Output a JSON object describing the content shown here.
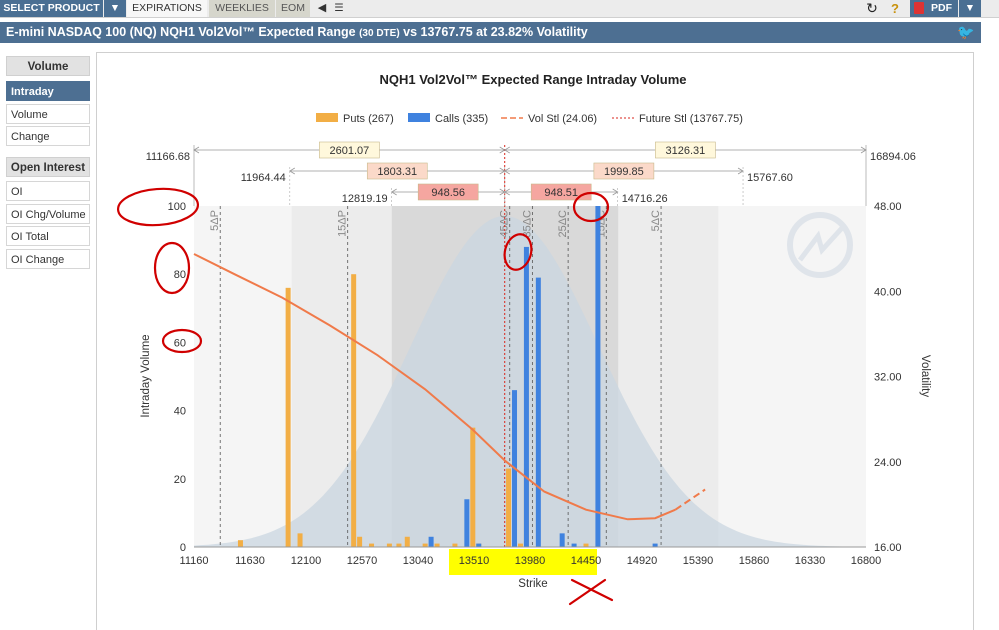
{
  "toolbar": {
    "select_product": "SELECT PRODUCT",
    "tabs": [
      "EXPIRATIONS",
      "WEEKLIES",
      "EOM"
    ],
    "pdf": "PDF"
  },
  "header": {
    "title_main": "E-mini NASDAQ 100 (NQ) NQH1 Vol2Vol™ Expected Range",
    "title_dte": "(30 DTE)",
    "title_tail": "vs 13767.75 at 23.82% Volatility"
  },
  "sidebar": {
    "volume_header": "Volume",
    "volume_items": [
      "Intraday",
      "Volume",
      "Change"
    ],
    "oi_header": "Open Interest",
    "oi_items": [
      "OI",
      "OI Chg/Volume",
      "OI Total",
      "OI Change"
    ],
    "active": "Intraday"
  },
  "colors": {
    "puts": "#f2ae45",
    "calls": "#3f82df",
    "vol_line": "#f07a4a",
    "future_line": "#d9261c",
    "bell": "#c9d5e0",
    "band_dark": "#d9d9d9",
    "band_light": "#ececec",
    "range_fill": "#f5a6a0",
    "range_fill_light": "#fbd9c9",
    "box_fill": "#fff8dc",
    "annotation": "#d00000",
    "highlight": "#ffff00"
  },
  "chart_data": {
    "type": "bar",
    "title": "NQH1 Vol2Vol™ Expected Range Intraday Volume",
    "xlabel": "Strike",
    "ylabel": "Intraday Volume",
    "y2label": "Volatility",
    "xlim": [
      11160,
      16800
    ],
    "ylim": [
      0,
      100
    ],
    "y2lim": [
      16,
      48
    ],
    "x_ticks": [
      11160,
      11630,
      12100,
      12570,
      13040,
      13510,
      13980,
      14450,
      14920,
      15390,
      15860,
      16330,
      16800
    ],
    "y_ticks": [
      0,
      20,
      40,
      60,
      80,
      100
    ],
    "y2_ticks": [
      "16.00",
      "24.00",
      "32.00",
      "40.00",
      "48.00"
    ],
    "legend": [
      {
        "name": "Puts (267)",
        "kind": "bar",
        "color": "#f2ae45"
      },
      {
        "name": "Calls (335)",
        "kind": "bar",
        "color": "#3f82df"
      },
      {
        "name": "Vol Stl (24.06)",
        "kind": "dash",
        "color": "#f07a4a"
      },
      {
        "name": "Future Stl (13767.75)",
        "kind": "dot",
        "color": "#d9261c"
      }
    ],
    "series": [
      {
        "name": "Puts (267)",
        "strikes": [
          11550,
          11950,
          12050,
          12500,
          12550,
          12650,
          12800,
          12880,
          12950,
          13100,
          13200,
          13350,
          13500,
          13550,
          13800,
          13900,
          13950,
          14450
        ],
        "values": [
          2,
          76,
          4,
          80,
          3,
          1,
          1,
          1,
          3,
          1,
          1,
          1,
          35,
          1,
          23,
          1,
          23,
          1
        ]
      },
      {
        "name": "Calls (335)",
        "strikes": [
          13150,
          13450,
          13550,
          13850,
          13950,
          14050,
          14250,
          14350,
          14550,
          15030
        ],
        "values": [
          3,
          14,
          1,
          46,
          88,
          79,
          4,
          1,
          100,
          1
        ]
      }
    ],
    "vol_curve": {
      "solid": [
        [
          11160,
          43.5
        ],
        [
          11500,
          41.6
        ],
        [
          11900,
          39.4
        ],
        [
          12300,
          36.8
        ],
        [
          12700,
          34.0
        ],
        [
          13100,
          30.8
        ],
        [
          13500,
          27.0
        ],
        [
          13770,
          24.1
        ],
        [
          14100,
          21.2
        ],
        [
          14450,
          19.5
        ],
        [
          14800,
          18.6
        ],
        [
          15030,
          18.7
        ],
        [
          15200,
          19.5
        ]
      ],
      "dashed": [
        [
          15200,
          19.5
        ],
        [
          15450,
          21.4
        ]
      ]
    },
    "future_settle": 13767.75,
    "vol_settle": 24.06,
    "delta_lines": [
      {
        "label": "5ΔP",
        "strike": 11380
      },
      {
        "label": "15ΔP",
        "strike": 12450
      },
      {
        "label": "45ΔC",
        "strike": 13810
      },
      {
        "label": "35ΔC",
        "strike": 14000
      },
      {
        "label": "25ΔC",
        "strike": 14300
      },
      {
        "label": "15ΔC",
        "strike": 14620
      },
      {
        "label": "5ΔC",
        "strike": 15080
      }
    ],
    "bands": [
      {
        "from": 11980,
        "to": 15560,
        "shade": "light"
      },
      {
        "from": 12820,
        "to": 14720,
        "shade": "dark"
      }
    ],
    "range_rows": [
      {
        "left_label": "11166.68",
        "right_label": "16894.06",
        "left": {
          "from": 11160,
          "to": 13768,
          "value": "2601.07",
          "style": "box"
        },
        "right": {
          "from": 13768,
          "to": 16800,
          "value": "3126.31",
          "style": "box"
        }
      },
      {
        "left_label": "11964.44",
        "right_label": "15767.60",
        "left": {
          "from": 11964,
          "to": 13768,
          "value": "1803.31",
          "style": "light"
        },
        "right": {
          "from": 13768,
          "to": 15768,
          "value": "1999.85",
          "style": "light"
        }
      },
      {
        "left_label": "12819.19",
        "right_label": "14716.26",
        "left": {
          "from": 12819,
          "to": 13768,
          "value": "948.56",
          "style": "dark"
        },
        "right": {
          "from": 13768,
          "to": 14716,
          "value": "948.51",
          "style": "dark"
        }
      }
    ]
  }
}
